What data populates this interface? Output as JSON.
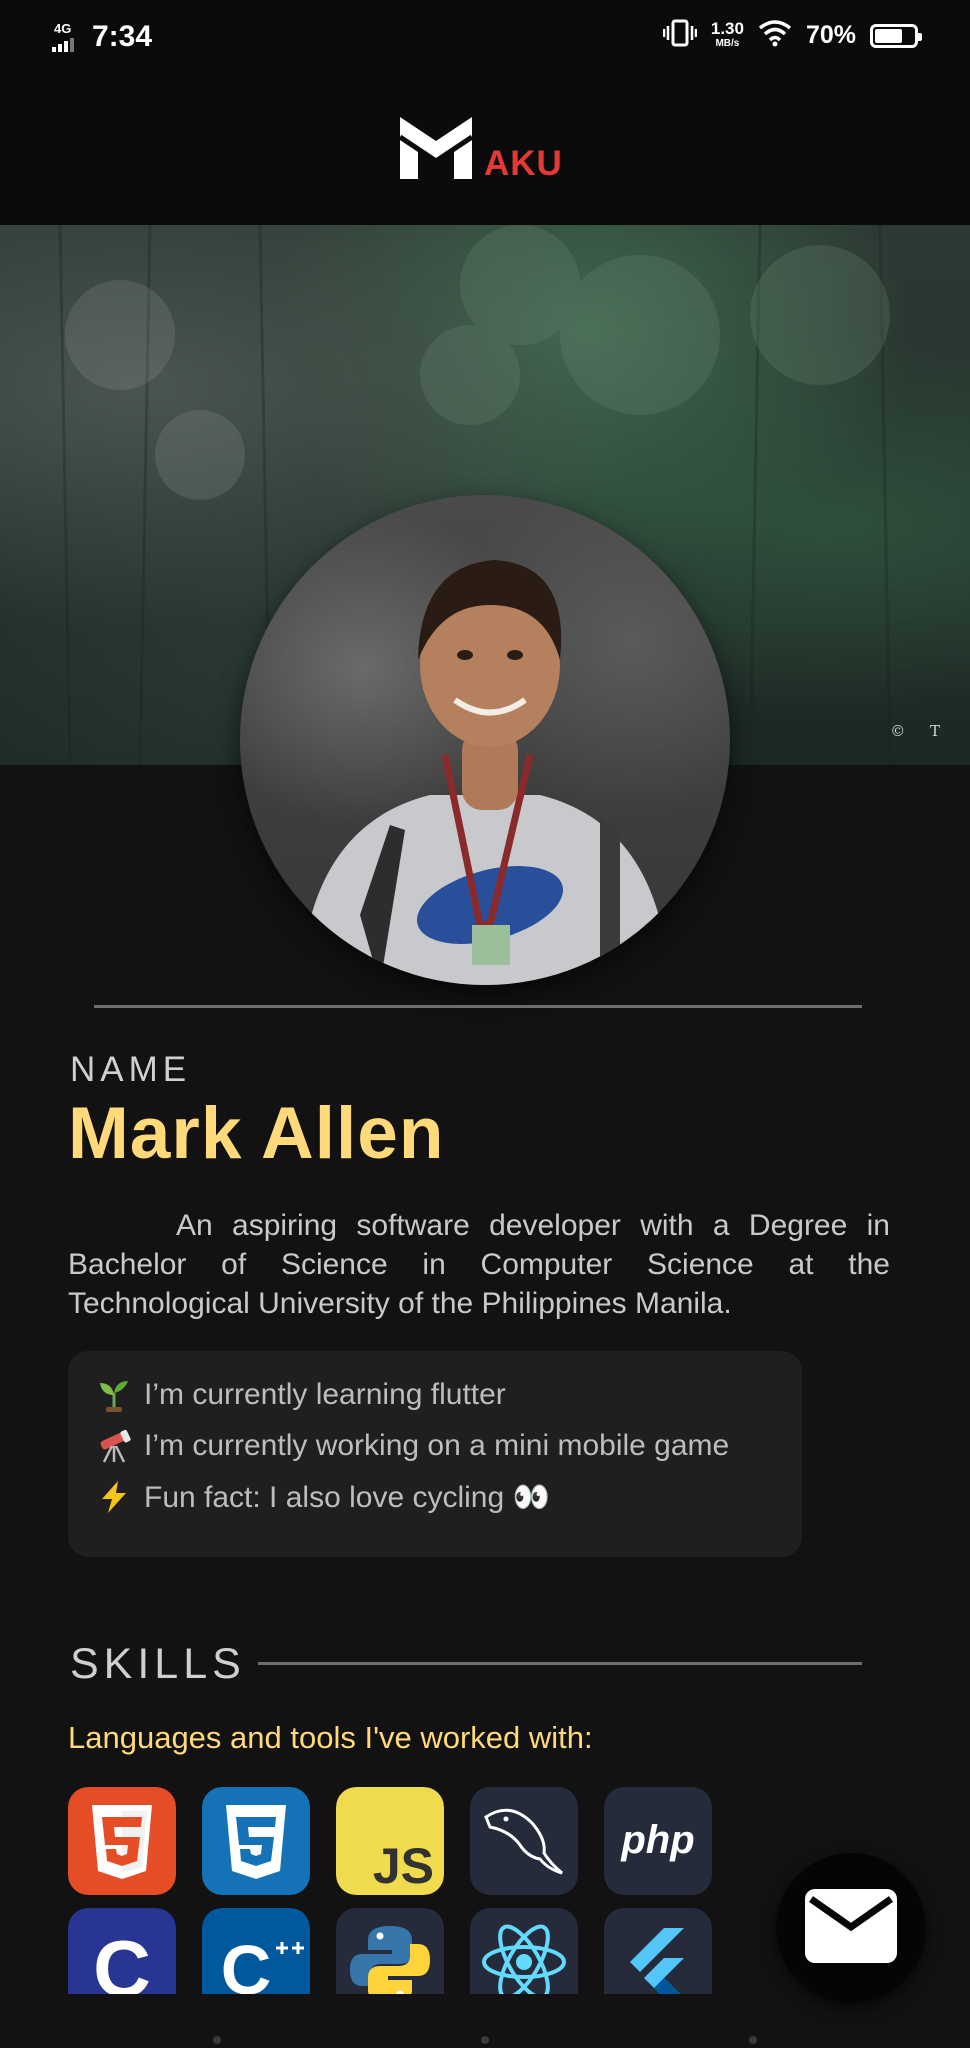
{
  "status_bar": {
    "network": "4G",
    "time": "7:34",
    "speed_value": "1.30",
    "speed_unit": "MB/s",
    "battery_percent": "70%",
    "battery_level": 0.7,
    "icons": [
      "vibrate-icon",
      "wifi-icon",
      "battery-icon"
    ]
  },
  "app_bar": {
    "logo_text": "AKU",
    "logo_icon": "m-logo-icon",
    "accent_color": "#e53935"
  },
  "hero": {
    "credit": "© T"
  },
  "profile": {
    "name_label": "NAME",
    "name": "Mark Allen",
    "bio": "An aspiring software developer with a Degree in Bachelor of Science in Computer Science at the Technological University of the Philippines Manila.",
    "accent_color": "#ffd97a"
  },
  "facts": [
    {
      "icon": "seedling-icon",
      "text": "I’m currently learning flutter"
    },
    {
      "icon": "telescope-icon",
      "text": "I’m currently working on a mini mobile game"
    },
    {
      "icon": "lightning-icon",
      "text": "Fun fact: I also love cycling 👀"
    }
  ],
  "skills": {
    "title": "SKILLS",
    "subtitle": "Languages and tools I've worked with:",
    "tools": [
      {
        "name": "HTML5",
        "icon": "html5-icon"
      },
      {
        "name": "CSS3",
        "icon": "css3-icon"
      },
      {
        "name": "JavaScript",
        "icon": "javascript-icon",
        "label": "JS"
      },
      {
        "name": "MySQL",
        "icon": "mysql-icon"
      },
      {
        "name": "PHP",
        "icon": "php-icon",
        "label": "php"
      },
      {
        "name": "C",
        "icon": "c-icon",
        "label": "C"
      },
      {
        "name": "C++",
        "icon": "cpp-icon",
        "label": "C"
      },
      {
        "name": "Python",
        "icon": "python-icon"
      },
      {
        "name": "React",
        "icon": "react-icon"
      },
      {
        "name": "Flutter",
        "icon": "flutter-icon"
      }
    ]
  },
  "fab": {
    "icon": "mail-icon"
  }
}
